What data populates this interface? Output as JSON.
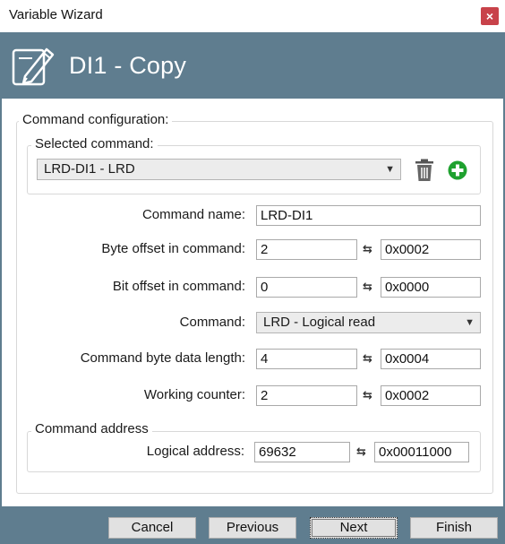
{
  "window": {
    "title": "Variable Wizard",
    "close_label": "×"
  },
  "banner": {
    "title": "DI1 - Copy",
    "icon": "edit-document-icon"
  },
  "config_group": {
    "legend": "Command configuration:"
  },
  "selected_command": {
    "legend": "Selected command:",
    "value": "LRD-DI1 - LRD",
    "delete_icon": "trash-icon",
    "add_icon": "add-circle-icon"
  },
  "fields": {
    "command_name": {
      "label": "Command name:",
      "value": "LRD-DI1"
    },
    "byte_offset": {
      "label": "Byte offset in command:",
      "value": "2",
      "hex": "0x0002"
    },
    "bit_offset": {
      "label": "Bit offset in command:",
      "value": "0",
      "hex": "0x0000"
    },
    "command": {
      "label": "Command:",
      "value": "LRD - Logical read"
    },
    "data_length": {
      "label": "Command byte data length:",
      "value": "4",
      "hex": "0x0004"
    },
    "working_counter": {
      "label": "Working counter:",
      "value": "2",
      "hex": "0x0002"
    }
  },
  "address_group": {
    "legend": "Command address",
    "logical_address": {
      "label": "Logical address:",
      "value": "69632",
      "hex": "0x00011000"
    }
  },
  "swap_glyph": "⇆",
  "buttons": {
    "cancel": "Cancel",
    "previous": "Previous",
    "next": "Next",
    "finish": "Finish"
  },
  "colors": {
    "header": "#5f7d8f",
    "add": "#1fa12f",
    "close": "#c8424a"
  }
}
